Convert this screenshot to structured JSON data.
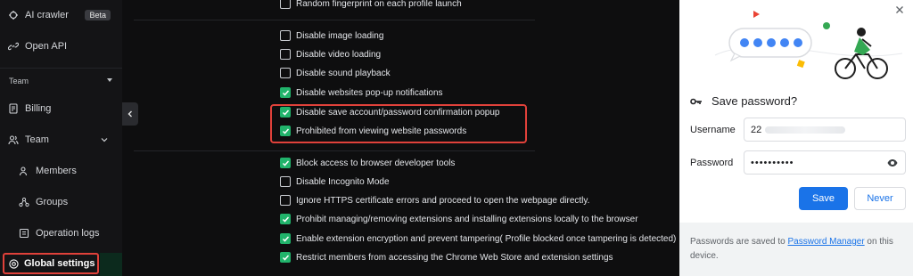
{
  "sidebar": {
    "ai_crawler": "AI crawler",
    "ai_badge": "Beta",
    "open_api": "Open API",
    "team_section": "Team",
    "billing": "Billing",
    "team": "Team",
    "members": "Members",
    "groups": "Groups",
    "operation_logs": "Operation logs",
    "global_settings": "Global settings"
  },
  "settings": {
    "options": [
      {
        "label": "Random fingerprint on each profile launch",
        "checked": false
      },
      {
        "label": "Disable image loading",
        "checked": false
      },
      {
        "label": "Disable video loading",
        "checked": false
      },
      {
        "label": "Disable sound playback",
        "checked": false
      },
      {
        "label": "Disable websites pop-up notifications",
        "checked": true
      },
      {
        "label": "Disable save account/password confirmation popup",
        "checked": true
      },
      {
        "label": "Prohibited from viewing website passwords",
        "checked": true
      },
      {
        "label": "Block access to browser developer tools",
        "checked": true
      },
      {
        "label": "Disable Incognito Mode",
        "checked": false
      },
      {
        "label": "Ignore HTTPS certificate errors and proceed to open the webpage directly.",
        "checked": false
      },
      {
        "label": "Prohibit managing/removing extensions and installing extensions locally to the browser",
        "checked": true
      },
      {
        "label": "Enable extension encryption and prevent tampering( Profile blocked once tampering is detected)",
        "checked": true
      },
      {
        "label": "Restrict members from accessing the Chrome Web Store and extension settings",
        "checked": true
      }
    ]
  },
  "dialog": {
    "title": "Save password?",
    "username_label": "Username",
    "username_value": "22",
    "password_label": "Password",
    "password_value": "••••••••••",
    "save_button": "Save",
    "never_button": "Never",
    "footer_prefix": "Passwords are saved to ",
    "footer_link": "Password Manager",
    "footer_suffix": " on this device."
  },
  "colors": {
    "accent_green": "#21b36b",
    "highlight_red": "#e0413a",
    "chrome_blue": "#1a73e8"
  }
}
